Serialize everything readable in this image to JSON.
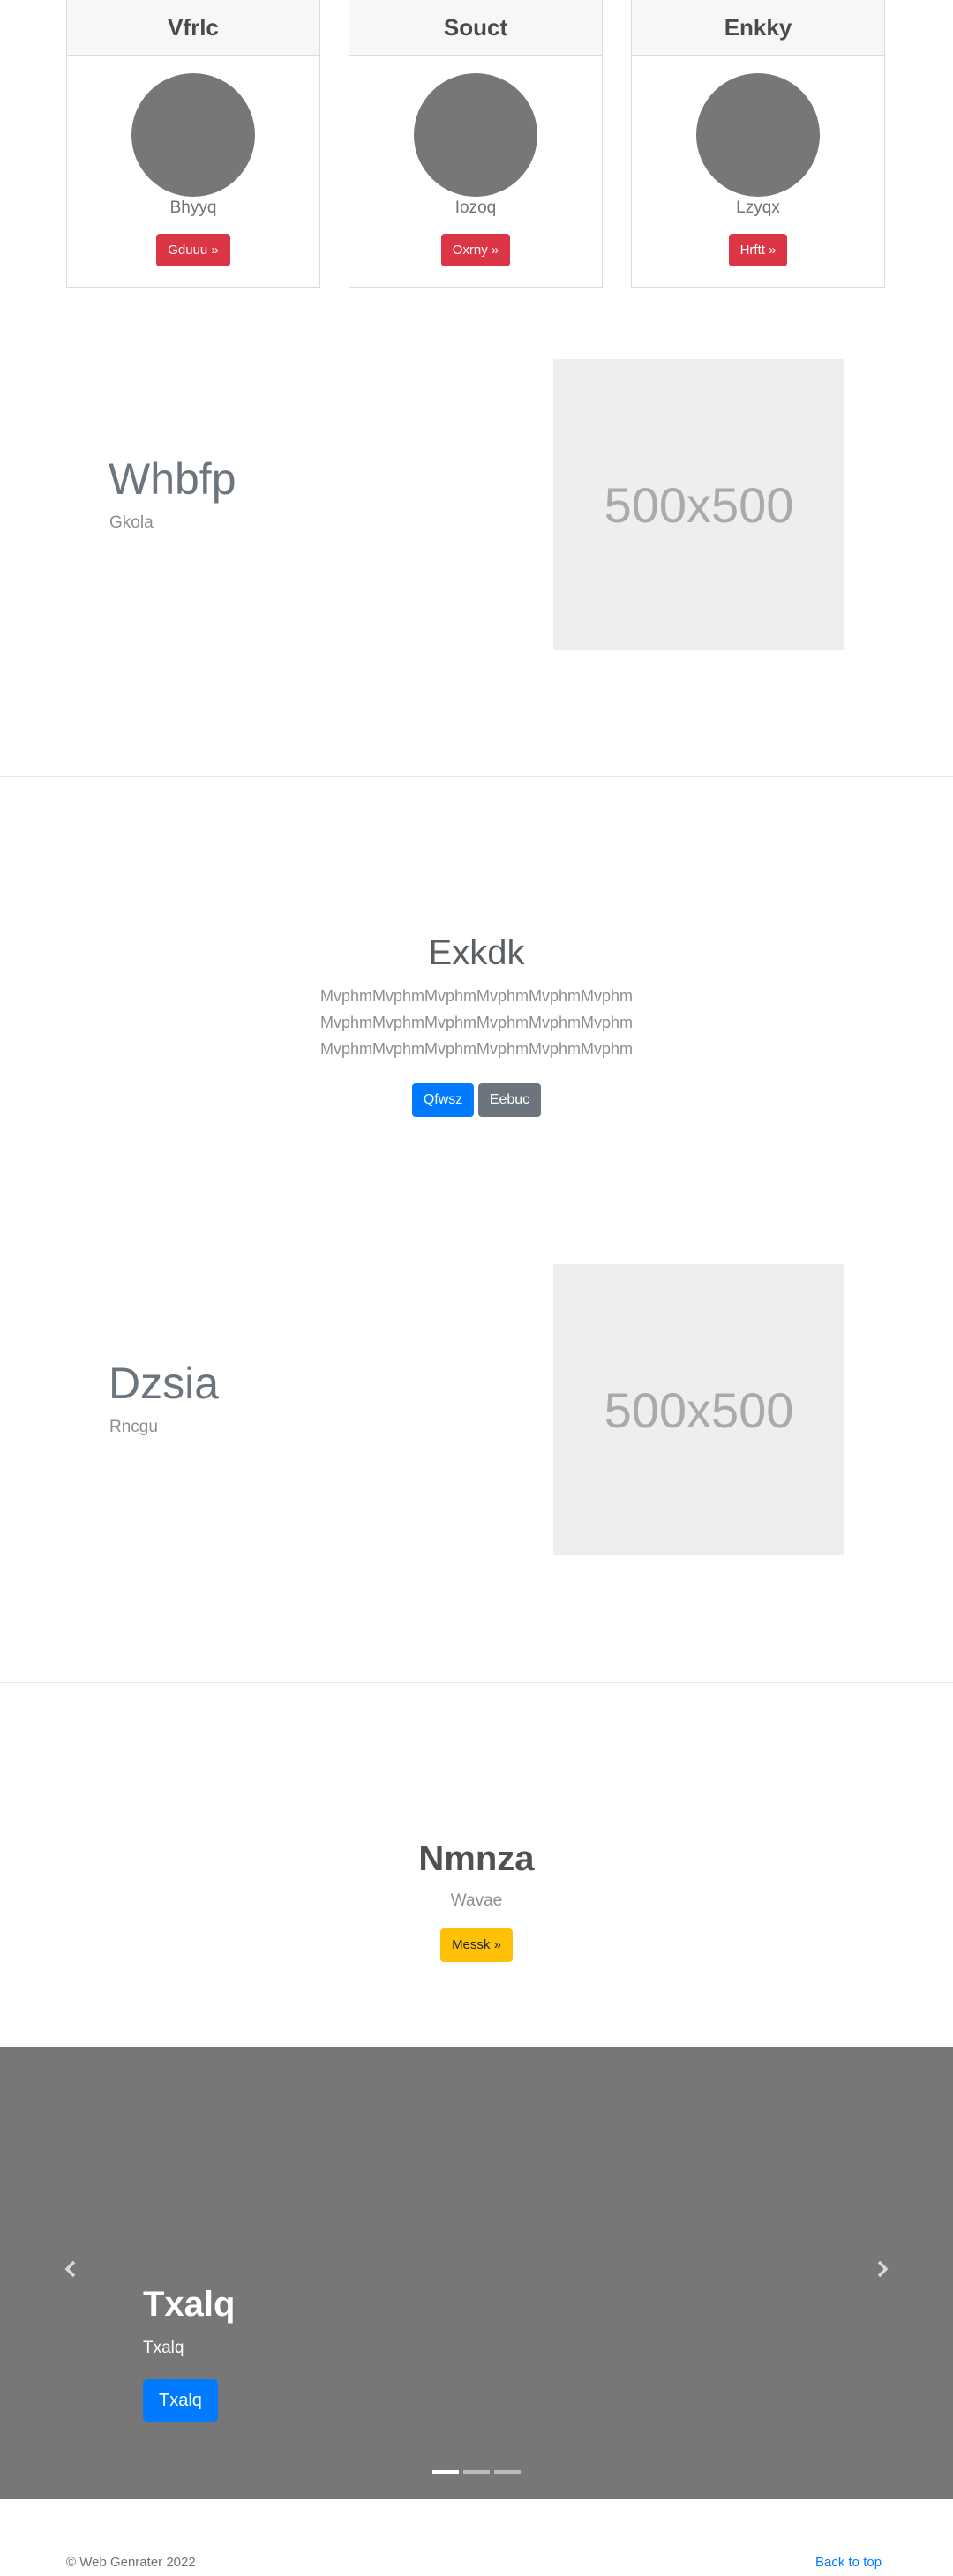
{
  "cards": [
    {
      "title": "Vfrlc",
      "text": "Bhyyq",
      "button": "Gduuu »"
    },
    {
      "title": "Souct",
      "text": "Iozoq",
      "button": "Oxrny »"
    },
    {
      "title": "Enkky",
      "text": "Lzyqx",
      "button": "Hrftt »"
    }
  ],
  "featurette1": {
    "heading": "Whbfp",
    "subheading": "Gkola",
    "image_label": "500x500"
  },
  "jumbotron": {
    "title": "Exkdk",
    "lines": [
      "MvphmMvphmMvphmMvphmMvphmMvphm",
      "MvphmMvphmMvphmMvphmMvphmMvphm",
      "MvphmMvphmMvphmMvphmMvphmMvphm"
    ],
    "primary_button": "Qfwsz",
    "secondary_button": "Eebuc"
  },
  "featurette2": {
    "heading": "Dzsia",
    "subheading": "Rncgu",
    "image_label": "500x500"
  },
  "album": {
    "title": "Nmnza",
    "subtitle": "Wavae",
    "button": "Messk »"
  },
  "carousel": {
    "title": "Txalq",
    "subtitle": "Txalq",
    "button": "Txalq",
    "prev_icon": "chevron-left-icon",
    "next_icon": "chevron-right-icon",
    "slide_count": 3,
    "active_slide": 1
  },
  "footer": {
    "copyright": "© Web Genrater 2022",
    "back_to_top": "Back to top"
  },
  "colors": {
    "danger": "#dc3545",
    "primary": "#007bff",
    "secondary": "#6c757d",
    "warning": "#ffc107",
    "carousel_bg": "#777777"
  }
}
